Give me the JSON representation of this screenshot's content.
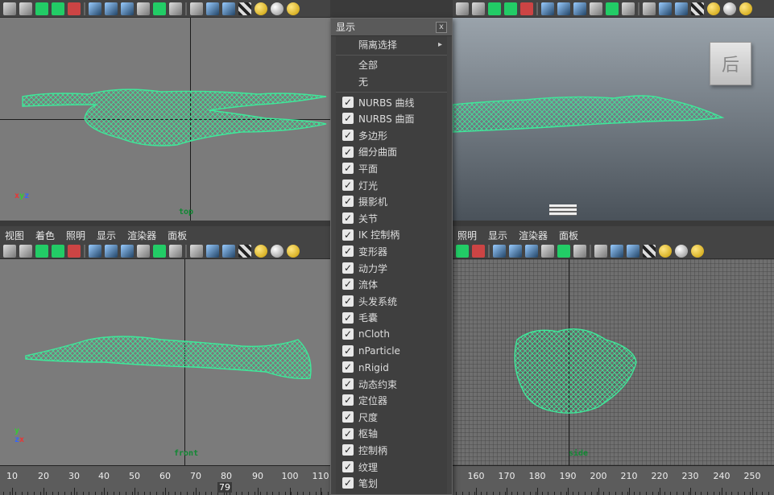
{
  "menu": {
    "title": "显示",
    "close": "x",
    "isolate": "隔离选择",
    "all": "全部",
    "none": "无",
    "items": [
      "NURBS 曲线",
      "NURBS 曲面",
      "多边形",
      "细分曲面",
      "平面",
      "灯光",
      "摄影机",
      "关节",
      "IK 控制柄",
      "变形器",
      "动力学",
      "流体",
      "头发系统",
      "毛囊",
      "nCloth",
      "nParticle",
      "nRigid",
      "动态约束",
      "定位器",
      "尺度",
      "枢轴",
      "控制柄",
      "纹理",
      "笔划"
    ]
  },
  "panel_menu": [
    "视图",
    "着色",
    "照明",
    "显示",
    "渲染器",
    "面板"
  ],
  "panel_menu_right": [
    "照明",
    "显示",
    "渲染器",
    "面板"
  ],
  "viewports": {
    "top_label": "top",
    "front_label": "front",
    "side_label": "side",
    "persp_cube": "后"
  },
  "timeline": {
    "ticks": [
      "10",
      "20",
      "30",
      "40",
      "50",
      "60",
      "70",
      "80",
      "90",
      "100",
      "110",
      "160",
      "170",
      "180",
      "190",
      "200",
      "210",
      "220",
      "230",
      "240",
      "250"
    ],
    "current": "79"
  },
  "colors": {
    "wireframe": "#3fe89a",
    "accent": "#e8e8e8"
  }
}
